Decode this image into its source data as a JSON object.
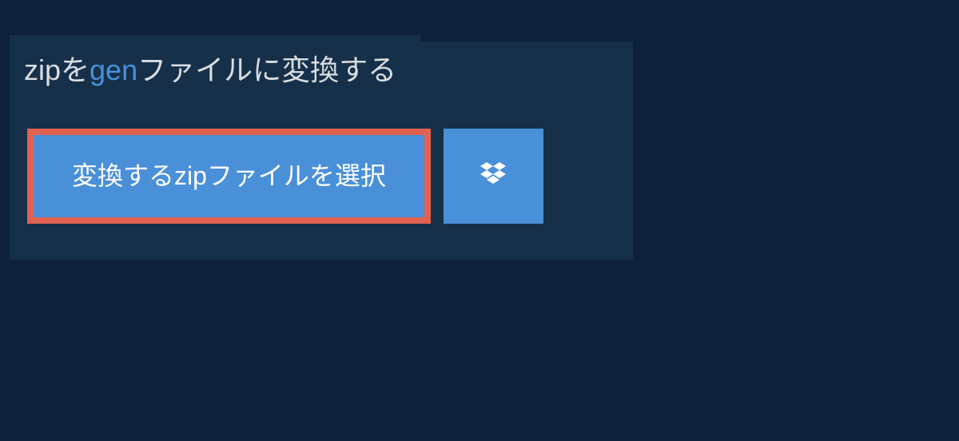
{
  "heading": {
    "part1": "zipを",
    "accent": "gen",
    "part2": "ファイルに変換する"
  },
  "buttons": {
    "select_label": "変換するzipファイルを選択",
    "dropbox_label": "Dropbox"
  }
}
